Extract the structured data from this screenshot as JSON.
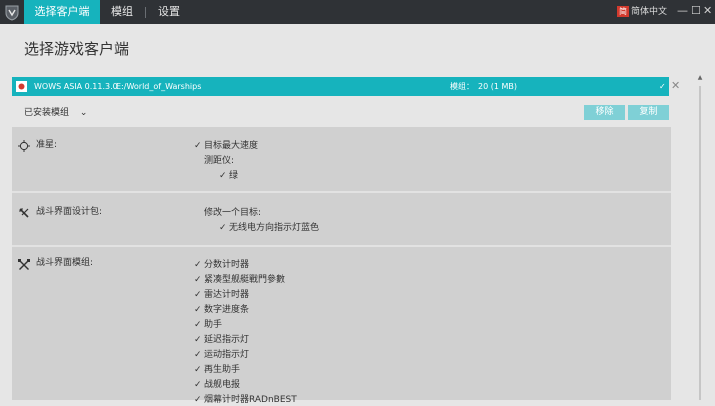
{
  "titlebar": {
    "tabs": [
      {
        "label": "选择客户端",
        "active": true
      },
      {
        "label": "模组",
        "active": false
      },
      {
        "label": "设置",
        "active": false
      }
    ],
    "language_flag": "简",
    "language": "简体中文",
    "controls": {
      "minimize": "—",
      "maximize": "☐",
      "close": "✕"
    }
  },
  "page": {
    "title": "选择游戏客户端"
  },
  "client": {
    "name": "WOWS ASIA 0.11.3.0",
    "path": "E:/World_of_Warships",
    "mods_label": "模组：",
    "mods_value": "20 (1 MB)",
    "check": "✓",
    "close": "✕"
  },
  "installed": {
    "label": "已安装模组",
    "chevron": "⌄"
  },
  "actions": {
    "remove": "移除",
    "copy": "复制"
  },
  "sections": [
    {
      "title": "准星:",
      "icon": "crosshair-icon",
      "items": [
        {
          "text": "目标最大速度",
          "checked": true,
          "level": 0
        },
        {
          "text": "测距仪:",
          "checked": false,
          "level": 0
        },
        {
          "text": "绿",
          "checked": true,
          "level": 1
        }
      ]
    },
    {
      "title": "战斗界面设计包:",
      "icon": "tools-icon",
      "items": [
        {
          "text": "修改一个目标:",
          "checked": false,
          "level": 0
        },
        {
          "text": "无线电方向指示灯蓝色",
          "checked": true,
          "level": 1
        }
      ]
    },
    {
      "title": "战斗界面模组:",
      "icon": "crossed-tools-icon",
      "items": [
        {
          "text": "分数计时器",
          "checked": true,
          "level": 0
        },
        {
          "text": "紧凑型舰艇戰門參數",
          "checked": true,
          "level": 0
        },
        {
          "text": "雷达计时器",
          "checked": true,
          "level": 0
        },
        {
          "text": "数字进度条",
          "checked": true,
          "level": 0
        },
        {
          "text": "助手",
          "checked": true,
          "level": 0
        },
        {
          "text": "延迟指示灯",
          "checked": true,
          "level": 0
        },
        {
          "text": "运动指示灯",
          "checked": true,
          "level": 0
        },
        {
          "text": "再生助手",
          "checked": true,
          "level": 0
        },
        {
          "text": "战舰电报",
          "checked": true,
          "level": 0
        },
        {
          "text": "烟幕计时器RADnBEST",
          "checked": true,
          "level": 0
        }
      ]
    }
  ],
  "colors": {
    "accent": "#16b3bd",
    "titlebar": "#2f3236",
    "panel": "#d0d0d0",
    "button": "#7fd0d6"
  }
}
